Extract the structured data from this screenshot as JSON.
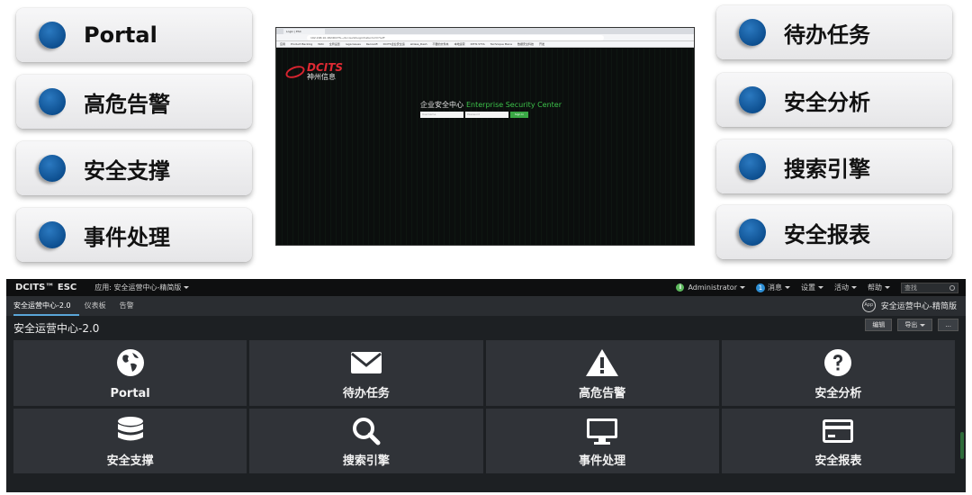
{
  "cards_left": [
    {
      "label": "Portal"
    },
    {
      "label": "高危告警"
    },
    {
      "label": "安全支撑"
    },
    {
      "label": "事件处理"
    }
  ],
  "cards_right": [
    {
      "label": "待办任务"
    },
    {
      "label": "安全分析"
    },
    {
      "label": "搜索引擎"
    },
    {
      "label": "安全报表"
    }
  ],
  "login_screenshot": {
    "tab_title": "Login | ESC",
    "address": "192.168.10.182/DCITS~/Account/Login?returnUrl=%2F",
    "bookmarks": [
      "应用",
      "Product Backlog",
      "WiKi",
      "全局设置",
      "rega Issues",
      "Recosoft",
      "DCITS企业安全运",
      "aClass_Dash",
      "不要的文件夹",
      "本地运营",
      "DITIS STYA",
      "Technique Mana",
      "数据安全科技",
      "开发"
    ],
    "logo_en": "DCITS",
    "logo_cn": "神州信息",
    "title_cn": "企业安全中心",
    "title_en": "Enterprise Security Center",
    "username_placeholder": "Username",
    "password_placeholder": "Password",
    "signin_label": "Sign In"
  },
  "dashboard": {
    "brand": "DCITS™ ESC",
    "app_menu": "应用: 安全运营中心-精简版",
    "user": "Administrator",
    "messages_count": "1",
    "messages_label": "消息",
    "settings_label": "设置",
    "activity_label": "活动",
    "help_label": "帮助",
    "search_placeholder": "查找",
    "tabs": [
      "安全运营中心-2.0",
      "仪表板",
      "告警"
    ],
    "app_badge": "App",
    "app_name": "安全运营中心-精简版",
    "title": "安全运营中心-2.0",
    "edit_label": "编辑",
    "export_label": "导出",
    "more_label": "...",
    "tiles": [
      {
        "label": "Portal",
        "icon": "globe-icon"
      },
      {
        "label": "待办任务",
        "icon": "envelope-icon"
      },
      {
        "label": "高危告警",
        "icon": "warning-icon"
      },
      {
        "label": "安全分析",
        "icon": "question-icon"
      },
      {
        "label": "安全支撑",
        "icon": "database-icon"
      },
      {
        "label": "搜索引擎",
        "icon": "search-icon"
      },
      {
        "label": "事件处理",
        "icon": "monitor-icon"
      },
      {
        "label": "安全报表",
        "icon": "card-icon"
      }
    ]
  }
}
